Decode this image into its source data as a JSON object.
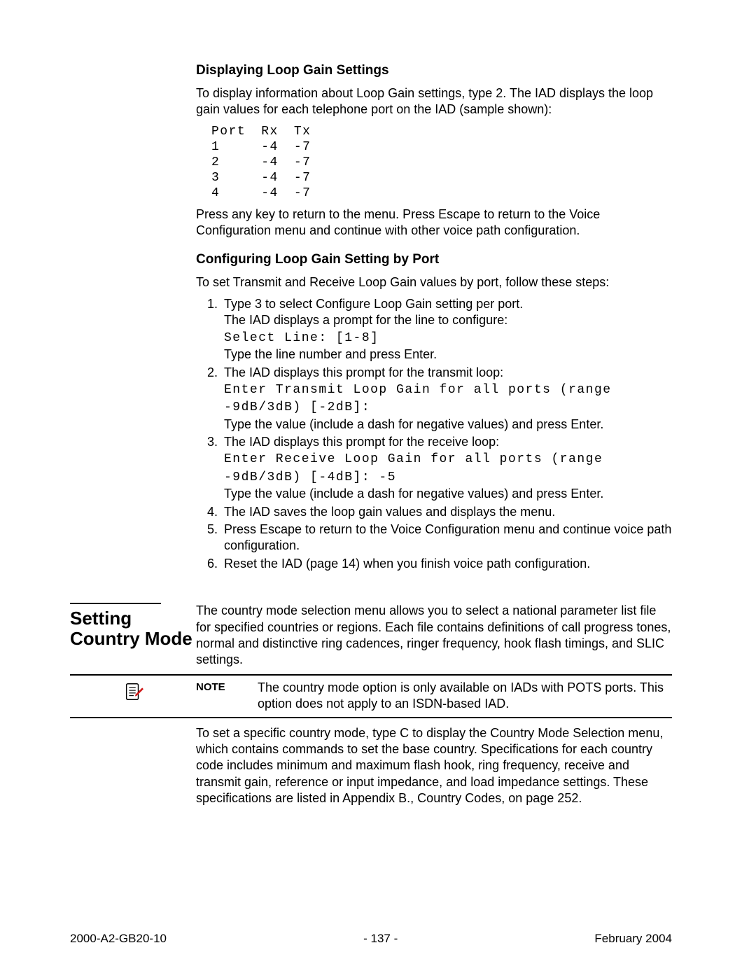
{
  "sec1": {
    "heading": "Displaying Loop Gain Settings",
    "intro": "To display information about Loop Gain settings, type 2. The IAD displays the loop gain values for each telephone port on the IAD (sample shown):",
    "table": {
      "headers": {
        "c0": "Port",
        "c1": "Rx",
        "c2": "Tx"
      },
      "rows": [
        {
          "c0": "1",
          "c1": "-4",
          "c2": "-7"
        },
        {
          "c0": "2",
          "c1": "-4",
          "c2": "-7"
        },
        {
          "c0": "3",
          "c1": "-4",
          "c2": "-7"
        },
        {
          "c0": "4",
          "c1": "-4",
          "c2": "-7"
        }
      ]
    },
    "after": "Press any key to return to the menu. Press Escape to return to the Voice Configuration menu and continue with other voice path configuration."
  },
  "sec2": {
    "heading": "Configuring Loop Gain Setting by Port",
    "intro": "To set Transmit and Receive Loop Gain values by port, follow these steps:",
    "steps": {
      "s1a": "Type 3 to select Configure Loop Gain setting per port.",
      "s1b": "The IAD displays a prompt for the line to configure:",
      "s1c": "Select Line: [1-8]",
      "s1d": "Type the line number and press Enter.",
      "s2a": "The IAD displays this prompt for the transmit loop:",
      "s2b": "Enter Transmit Loop Gain for all ports (range -9dB/3dB) [-2dB]:",
      "s2c": "Type the value (include a dash for negative values) and press Enter.",
      "s3a": "The IAD displays this prompt for the receive loop:",
      "s3b": "Enter Receive Loop Gain for all ports (range -9dB/3dB) [-4dB]: -5",
      "s3c": "Type the value (include a dash for negative values) and press Enter.",
      "s4": "The IAD saves the loop gain values and displays the menu.",
      "s5": "Press Escape to return to the Voice Configuration menu and continue voice path configuration.",
      "s6": "Reset the IAD (page 14) when you finish voice path configuration."
    }
  },
  "sec3": {
    "side_heading": "Setting Country Mode",
    "p1": "The country mode selection menu allows you to select a national parameter list file for specified countries or regions. Each file contains definitions of call progress tones, normal and distinctive ring cadences, ringer frequency, hook flash timings, and SLIC settings.",
    "note_label": "NOTE",
    "note_text": "The country mode option is only available on IADs with POTS ports. This option does not apply to an ISDN-based IAD.",
    "p2": "To set a specific country mode, type C to display the Country Mode Selection menu, which contains commands to set the base country. Specifications for each country code includes minimum and maximum flash hook, ring frequency, receive and transmit gain, reference or input impedance, and load impedance settings. These specifications are listed in Appendix B., Country Codes, on page 252."
  },
  "footer": {
    "left": "2000-A2-GB20-10",
    "center": "- 137 -",
    "right": "February 2004"
  }
}
